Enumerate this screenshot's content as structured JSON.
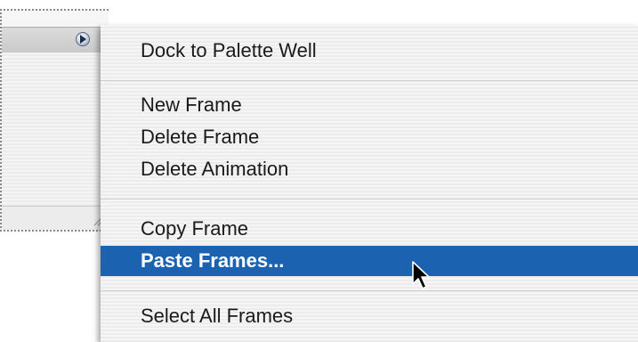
{
  "palette": {
    "menu_button_icon": "play-triangle-icon",
    "grow_box_icon": "resize-grip-icon"
  },
  "context_menu": {
    "items": [
      {
        "label": "Dock to Palette Well"
      },
      {
        "label": "New Frame"
      },
      {
        "label": "Delete Frame"
      },
      {
        "label": "Delete Animation"
      },
      {
        "label": "Copy Frame"
      },
      {
        "label": "Paste Frames...",
        "selected": true
      },
      {
        "label": "Select All Frames"
      }
    ],
    "highlight_color": "#1b63b0"
  },
  "cursor": {
    "icon": "arrow-pointer-icon"
  }
}
